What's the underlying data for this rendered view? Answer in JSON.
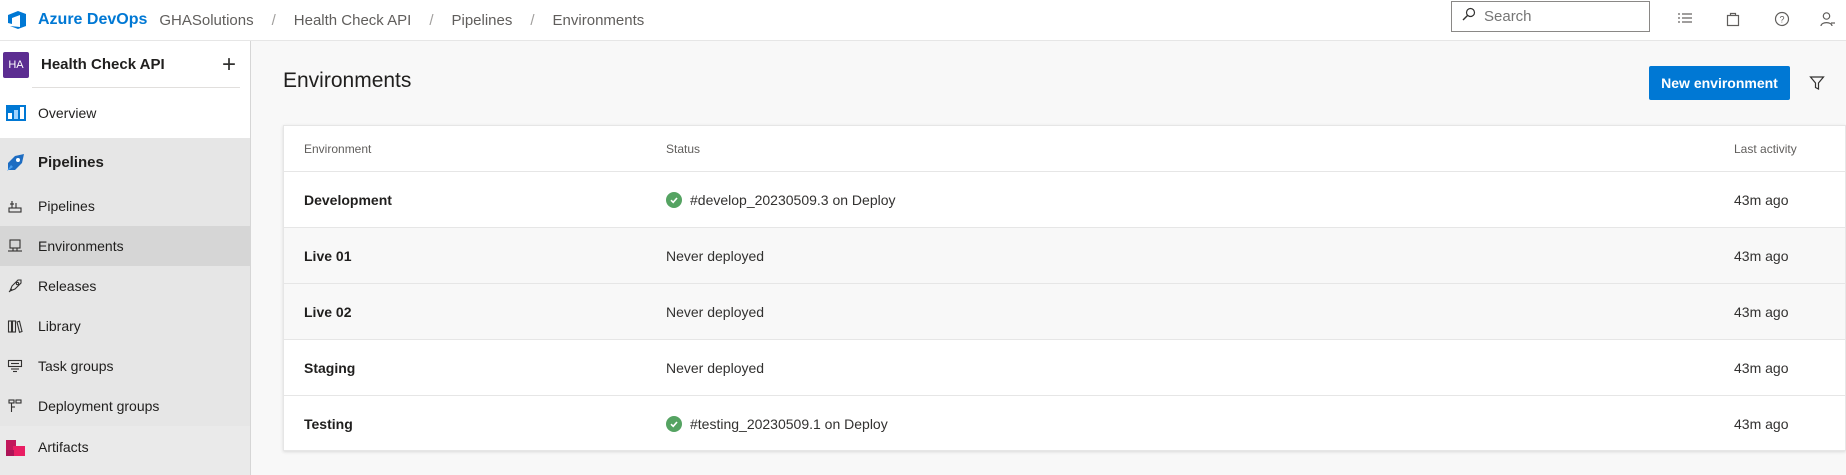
{
  "header": {
    "brand": "Azure DevOps",
    "breadcrumbs": [
      "GHASolutions",
      "Health Check API",
      "Pipelines",
      "Environments"
    ],
    "separator": "/",
    "search_placeholder": "Search"
  },
  "sidebar": {
    "project_initials": "HA",
    "project_name": "Health Check API",
    "add_label": "+",
    "overview": "Overview",
    "section": "Pipelines",
    "items": [
      {
        "label": "Pipelines",
        "icon": "pipelines-icon"
      },
      {
        "label": "Environments",
        "icon": "environments-icon",
        "selected": true
      },
      {
        "label": "Releases",
        "icon": "releases-icon"
      },
      {
        "label": "Library",
        "icon": "library-icon"
      },
      {
        "label": "Task groups",
        "icon": "task-groups-icon"
      },
      {
        "label": "Deployment groups",
        "icon": "deployment-groups-icon"
      }
    ],
    "artifacts": "Artifacts"
  },
  "main": {
    "title": "Environments",
    "new_button": "New environment",
    "columns": {
      "environment": "Environment",
      "status": "Status",
      "last_activity": "Last activity"
    },
    "rows": [
      {
        "environment": "Development",
        "status": "#develop_20230509.3 on Deploy",
        "succeeded": true,
        "last_activity": "43m ago"
      },
      {
        "environment": "Live 01",
        "status": "Never deployed",
        "succeeded": false,
        "last_activity": "43m ago"
      },
      {
        "environment": "Live 02",
        "status": "Never deployed",
        "succeeded": false,
        "last_activity": "43m ago"
      },
      {
        "environment": "Staging",
        "status": "Never deployed",
        "succeeded": false,
        "last_activity": "43m ago"
      },
      {
        "environment": "Testing",
        "status": "#testing_20230509.1 on Deploy",
        "succeeded": true,
        "last_activity": "43m ago"
      }
    ]
  },
  "colors": {
    "accent": "#0078d4",
    "success": "#55a362",
    "project_avatar": "#5c2d91"
  }
}
